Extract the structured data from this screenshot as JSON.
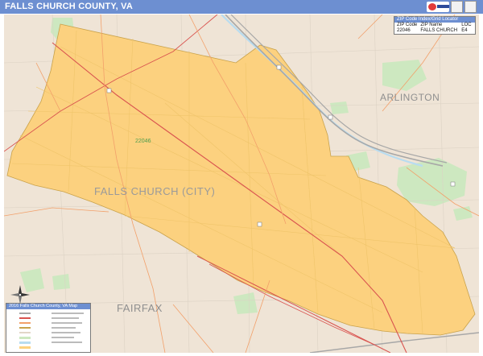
{
  "title": "FALLS CHURCH COUNTY, VA",
  "colors": {
    "title_bar": "#6d8fd1",
    "land": "#efe4d6",
    "city_fill": "#fcd17f",
    "city_border": "#c9a24b",
    "water": "#b8dcf0",
    "parks": "#cde8c0",
    "highway": "#a0a0a0",
    "major_road": "#d9534f",
    "arterial": "#f2a06a"
  },
  "map": {
    "regions": {
      "arlington": "ARLINGTON",
      "fairfax": "FAIRFAX",
      "city": "FALLS CHURCH (CITY)"
    },
    "zip_label": "22046"
  },
  "zip_table": {
    "title": "ZIP Code Index/Grid Locator",
    "headers": [
      "ZIP Code",
      "ZIP Name",
      "LOC"
    ],
    "rows": [
      [
        "22046",
        "FALLS CHURCH",
        "E4"
      ]
    ]
  },
  "legend": {
    "title": "2016 Falls Church County, VA Map"
  },
  "icons": {
    "compass": "compass-rose-icon",
    "brand": "brand-logo"
  }
}
